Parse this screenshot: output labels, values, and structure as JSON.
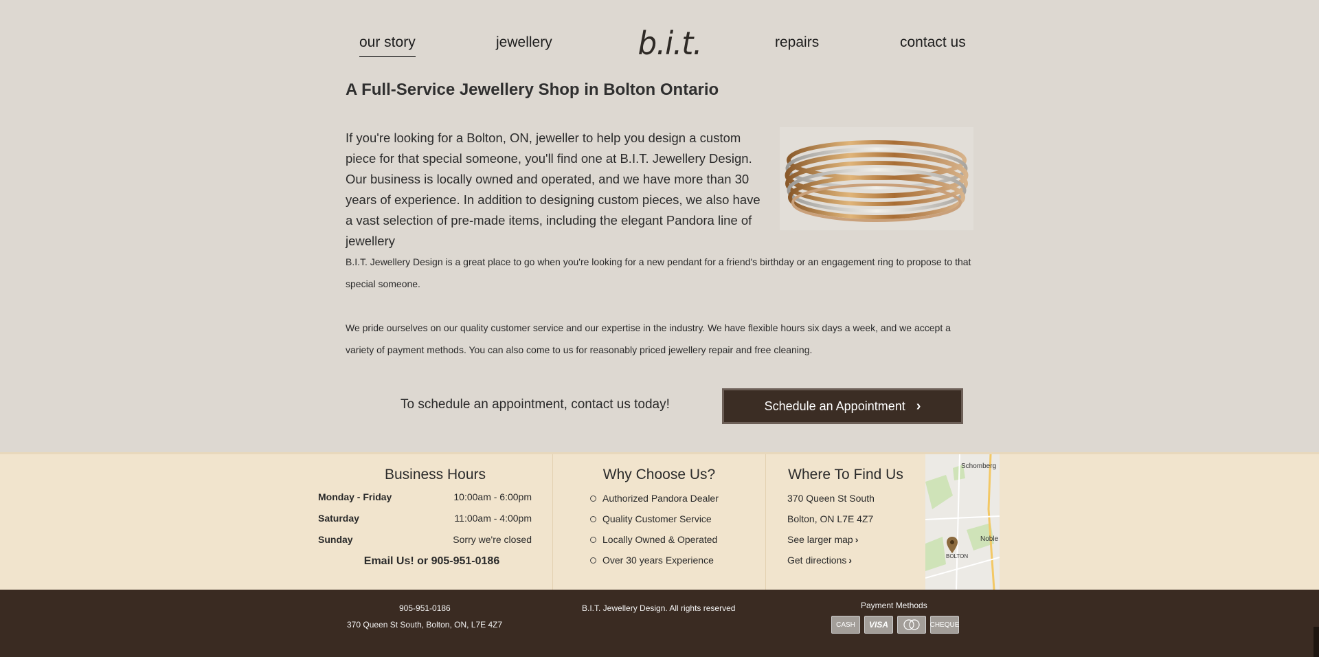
{
  "nav": {
    "our_story": "our story",
    "jewellery": "jewellery",
    "logo": "b.i.t.",
    "repairs": "repairs",
    "contact": "contact us"
  },
  "main": {
    "heading": "A Full-Service Jewellery Shop in Bolton Ontario",
    "intro": "If you're looking for a Bolton, ON, jeweller to help you design a custom piece for that special someone, you'll find one at B.I.T. Jewellery Design. Our business is locally owned and operated, and we have more than 30 years of experience. In addition to designing custom pieces, we also have a vast selection of pre-made items, including the elegant Pandora line of jewellery",
    "para1": "B.I.T. Jewellery Design is a great place to go when you're looking for a new pendant for a friend's birthday or an engagement ring to propose to that special someone.",
    "para2": "We pride ourselves on our quality customer service and our expertise in the industry. We have flexible hours six days a week, and we accept a variety of payment methods. You can also come to us for reasonably priced jewellery repair and free cleaning.",
    "cta_text": "To schedule an appointment, contact us today!",
    "cta_button": "Schedule an Appointment"
  },
  "hours": {
    "title": "Business Hours",
    "rows": [
      {
        "day": "Monday - Friday",
        "time": "10:00am - 6:00pm"
      },
      {
        "day": "Saturday",
        "time": "11:00am - 4:00pm"
      },
      {
        "day": "Sunday",
        "time": "Sorry we're closed"
      }
    ],
    "email_line": "Email Us! or 905-951-0186"
  },
  "why": {
    "title": "Why Choose Us?",
    "items": [
      "Authorized Pandora Dealer",
      "Quality Customer Service",
      "Locally Owned & Operated",
      "Over 30 years Experience"
    ]
  },
  "where": {
    "title": "Where To Find Us",
    "street": "370 Queen St South",
    "city": "Bolton, ON L7E 4Z7",
    "larger_map": "See larger map",
    "directions": "Get directions"
  },
  "map": {
    "labels": [
      "Schomberg",
      "Noble",
      "BOLTON"
    ]
  },
  "footer": {
    "phone": "905-951-0186",
    "address": "370 Queen St South, Bolton, ON, L7E 4Z7",
    "copyright": "B.I.T. Jewellery Design. All rights reserved",
    "payment_title": "Payment Methods",
    "payments": [
      "CASH",
      "VISA",
      "",
      "CHEQUE"
    ]
  },
  "colors": {
    "page_bg": "#ddd8d1",
    "band_bg": "#f1e4cd",
    "footer_bg": "#3a2b22",
    "button_bg": "#3b2d24"
  }
}
